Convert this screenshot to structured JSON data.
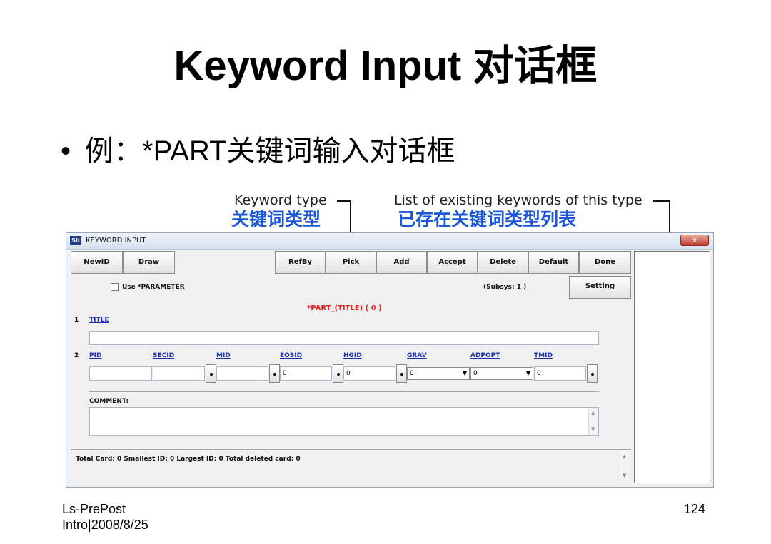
{
  "slide": {
    "title": "Keyword Input 对话框",
    "bullet": "例：*PART关键词输入对话框",
    "footer_left_line1": "Ls-PrePost",
    "footer_left_line2": "Intro|2008/8/25",
    "page_number": "124"
  },
  "callouts": {
    "keyword_type_en": "Keyword type",
    "keyword_type_cn": "关键词类型",
    "list_en": "List of existing keywords of this type",
    "list_cn": "已存在关键词类型列表"
  },
  "window": {
    "title": "KEYWORD INPUT",
    "icon_text": "SII",
    "close_label": "x",
    "buttons": {
      "newid": "NewID",
      "draw": "Draw",
      "refby": "RefBy",
      "pick": "Pick",
      "add": "Add",
      "accept": "Accept",
      "delete": "Delete",
      "default": "Default",
      "done": "Done",
      "setting": "Setting"
    },
    "use_parameter_label": "Use *PARAMETER",
    "subsys": "(Subsys: 1 )",
    "keyword_heading": "*PART_(TITLE)  ( 0 )",
    "card1_number": "1",
    "card1_title_label": "TITLE",
    "card2_number": "2",
    "card2_fields": [
      "PID",
      "SECID",
      "MID",
      "EOSID",
      "HGID",
      "GRAV",
      "ADPOPT",
      "TMID"
    ],
    "values": {
      "pid": "",
      "secid": "",
      "mid": "",
      "eosid": "0",
      "hgid": "0",
      "grav": "0",
      "adpopt": "0",
      "tmid": "0"
    },
    "comment_label": "COMMENT:",
    "status_text": "Total Card: 0   Smallest ID: 0   Largest ID: 0   Total deleted card: 0"
  }
}
